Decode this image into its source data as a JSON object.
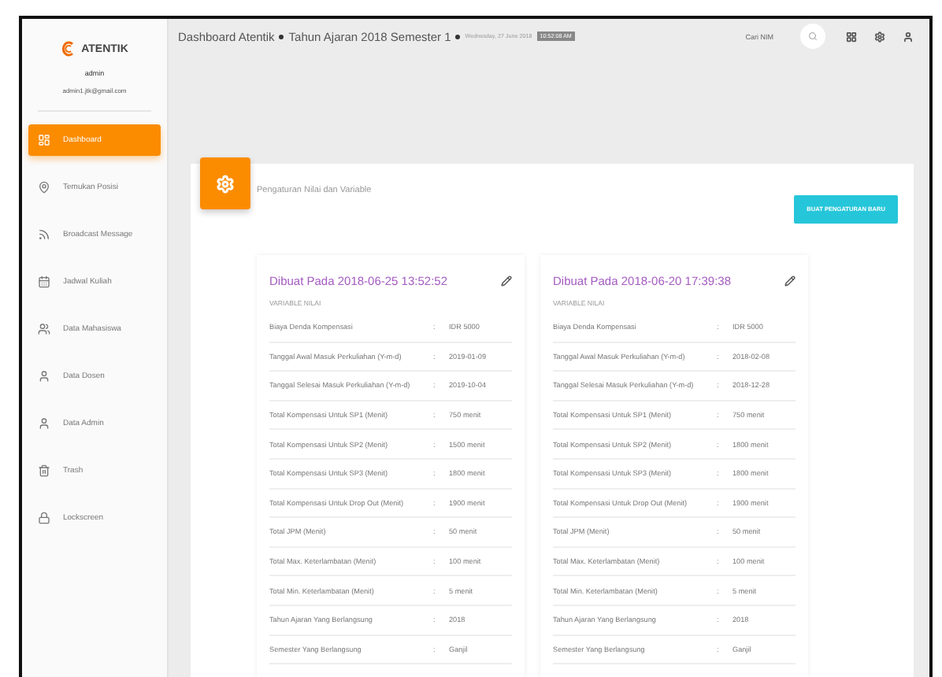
{
  "sidebar": {
    "brand": "ATENTIK",
    "user_name": "admin",
    "user_email": "admin1.jtk@gmail.com",
    "items": [
      {
        "label": "Dashboard",
        "selected": true
      },
      {
        "label": "Temukan Posisi",
        "selected": false
      },
      {
        "label": "Broadcast Message",
        "selected": false
      },
      {
        "label": "Jadwal Kuliah",
        "selected": false
      },
      {
        "label": "Data Mahasiswa",
        "selected": false
      },
      {
        "label": "Data Dosen",
        "selected": false
      },
      {
        "label": "Data Admin",
        "selected": false
      },
      {
        "label": "Trash",
        "selected": false
      },
      {
        "label": "Lockscreen",
        "selected": false
      }
    ]
  },
  "header": {
    "title": "Dashboard Atentik",
    "period": "Tahun Ajaran 2018 Semester 1",
    "date": "Wednesday, 27 June 2018",
    "time": "10:52:08 AM",
    "search_placeholder": "Cari NIM"
  },
  "panel": {
    "title": "Pengaturan Nilai dan Variable",
    "button": "BUAT PENGATURAN BARU",
    "cards": [
      {
        "created": "Dibuat Pada 2018-06-25 13:52:52",
        "section": "VARIABLE NILAI",
        "rows": [
          {
            "label": "Biaya Denda Kompensasi",
            "sep": ":",
            "value": "IDR 5000"
          },
          {
            "label": "Tanggal Awal Masuk Perkuliahan (Y-m-d)",
            "sep": ":",
            "value": "2019-01-09"
          },
          {
            "label": "Tanggal Selesai Masuk Perkuliahan (Y-m-d)",
            "sep": ":",
            "value": "2019-10-04"
          },
          {
            "label": "Total Kompensasi Untuk SP1 (Menit)",
            "sep": ":",
            "value": "750 menit"
          },
          {
            "label": "Total Kompensasi Untuk SP2 (Menit)",
            "sep": ":",
            "value": "1500 menit"
          },
          {
            "label": "Total Kompensasi Untuk SP3 (Menit)",
            "sep": ":",
            "value": "1800 menit"
          },
          {
            "label": "Total Kompensasi Untuk Drop Out (Menit)",
            "sep": ":",
            "value": "1900 menit"
          },
          {
            "label": "Total JPM (Menit)",
            "sep": ":",
            "value": "50 menit"
          },
          {
            "label": "Total Max. Keterlambatan (Menit)",
            "sep": ":",
            "value": "100 menit"
          },
          {
            "label": "Total Min. Keterlambatan (Menit)",
            "sep": ":",
            "value": "5 menit"
          },
          {
            "label": "Tahun Ajaran Yang Berlangsung",
            "sep": ":",
            "value": "2018"
          },
          {
            "label": "Semester Yang Berlangsung",
            "sep": ":",
            "value": "Ganjil"
          }
        ]
      },
      {
        "created": "Dibuat Pada 2018-06-20 17:39:38",
        "section": "VARIABLE NILAI",
        "rows": [
          {
            "label": "Biaya Denda Kompensasi",
            "sep": ":",
            "value": "IDR 5000"
          },
          {
            "label": "Tanggal Awal Masuk Perkuliahan (Y-m-d)",
            "sep": ":",
            "value": "2018-02-08"
          },
          {
            "label": "Tanggal Selesai Masuk Perkuliahan (Y-m-d)",
            "sep": ":",
            "value": "2018-12-28"
          },
          {
            "label": "Total Kompensasi Untuk SP1 (Menit)",
            "sep": ":",
            "value": "750 menit"
          },
          {
            "label": "Total Kompensasi Untuk SP2 (Menit)",
            "sep": ":",
            "value": "1800 menit"
          },
          {
            "label": "Total Kompensasi Untuk SP3 (Menit)",
            "sep": ":",
            "value": "1800 menit"
          },
          {
            "label": "Total Kompensasi Untuk Drop Out (Menit)",
            "sep": ":",
            "value": "1900 menit"
          },
          {
            "label": "Total JPM (Menit)",
            "sep": ":",
            "value": "50 menit"
          },
          {
            "label": "Total Max. Keterlambatan (Menit)",
            "sep": ":",
            "value": "100 menit"
          },
          {
            "label": "Total Min. Keterlambatan (Menit)",
            "sep": ":",
            "value": "5 menit"
          },
          {
            "label": "Tahun Ajaran Yang Berlangsung",
            "sep": ":",
            "value": "2018"
          },
          {
            "label": "Semester Yang Berlangsung",
            "sep": ":",
            "value": "Ganjil"
          }
        ]
      }
    ]
  }
}
